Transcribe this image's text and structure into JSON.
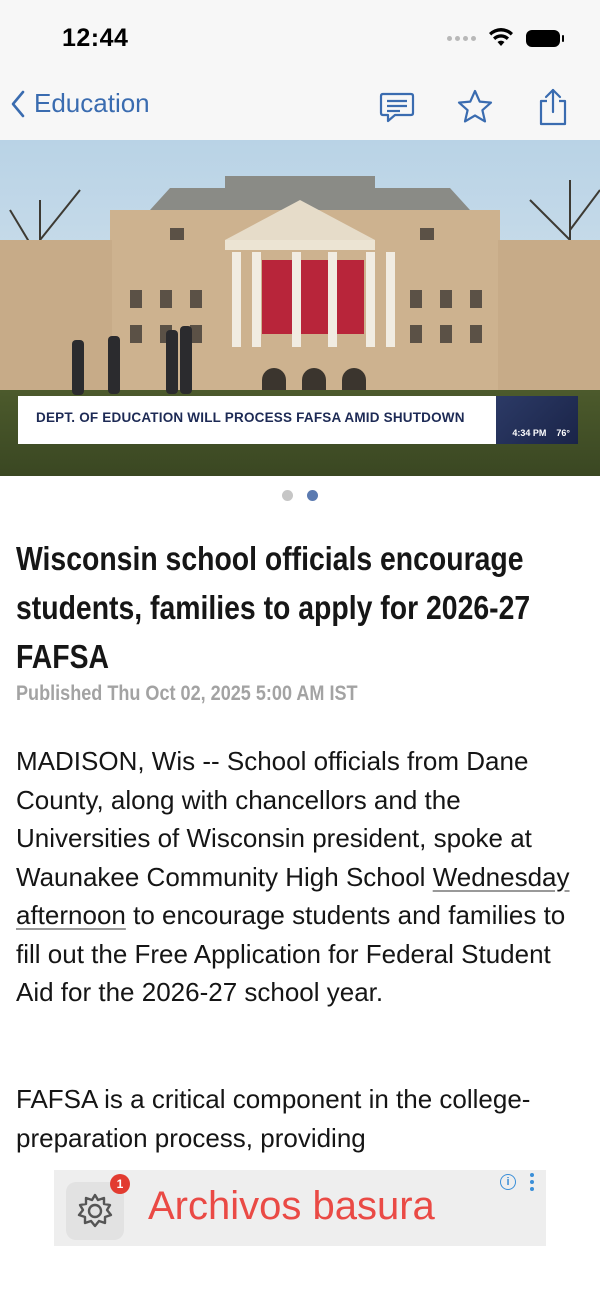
{
  "status_bar": {
    "time": "12:44"
  },
  "nav": {
    "back_label": "Education"
  },
  "hero": {
    "chyron": "DEPT. OF EDUCATION WILL PROCESS FAFSA AMID SHUTDOWN",
    "chyron_time": "4:34 PM",
    "chyron_temp": "76°",
    "carousel_pages": 2,
    "carousel_active": 2
  },
  "article": {
    "headline": "Wisconsin school officials encourage students, families to apply for 2026-27 FAFSA",
    "published": "Published Thu Oct 02, 2025 5:00 AM IST",
    "p1_before": "MADISON, Wis -- School officials from Dane County, along with chancellors and the Universities of Wisconsin president, spoke at Waunakee Community High School ",
    "p1_link": "Wednesday afternoon",
    "p1_after": " to encourage students and families to fill out the Free Application for Federal Student Aid for the 2026-27 school year.",
    "p2": "FAFSA is a critical component in the college-preparation process, providing"
  },
  "ad": {
    "badge_count": "1",
    "text": "Archivos basura",
    "info_glyph": "i"
  },
  "colors": {
    "accent": "#3a6cb0",
    "ad_text": "#ea4a45",
    "ad_badge": "#e23b30"
  }
}
